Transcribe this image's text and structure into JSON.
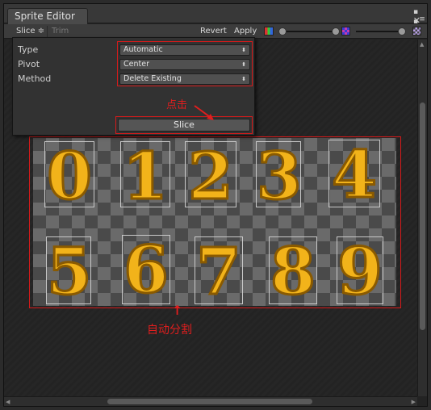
{
  "window": {
    "tab_title": "Sprite Editor",
    "close_glyph": "✕",
    "dots_glyph": "▪ ▪",
    "menu_glyph": "≡"
  },
  "toolbar": {
    "slice_menu": "Slice ≑",
    "trim": "Trim",
    "revert": "Revert",
    "apply": "Apply"
  },
  "slice_panel": {
    "type_label": "Type",
    "type_value": "Automatic",
    "pivot_label": "Pivot",
    "pivot_value": "Center",
    "method_label": "Method",
    "method_value": "Delete Existing",
    "dropdown_arrow": "⬍",
    "slice_button": "Slice"
  },
  "annotations": {
    "click_note": "点击",
    "auto_split_note": "自动分割",
    "arrow_up": "↑"
  },
  "sprites": {
    "d0": "0",
    "d1": "1",
    "d2": "2",
    "d3": "3",
    "d4": "4",
    "d5": "5",
    "d6": "6",
    "d7": "7",
    "d8": "8",
    "d9": "9"
  },
  "colors": {
    "annotation_red": "#d61a1a",
    "digit_gold": "#f2b31a"
  }
}
